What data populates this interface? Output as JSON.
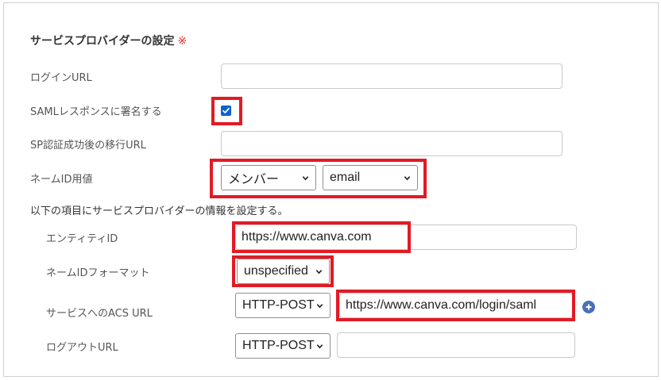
{
  "section": {
    "title": "サービスプロバイダーの設定",
    "required_mark": "※"
  },
  "fields": {
    "login_url": {
      "label": "ログインURL",
      "value": ""
    },
    "sign_saml": {
      "label": "SAMLレスポンスに署名する",
      "checked": true
    },
    "post_login_url": {
      "label": "SP認証成功後の移行URL",
      "value": ""
    },
    "name_id_value": {
      "label": "ネームID用値",
      "select1": "メンバー",
      "select2": "email"
    }
  },
  "subsection": {
    "intro": "以下の項目にサービスプロバイダーの情報を設定する。",
    "entity_id": {
      "label": "エンティティID",
      "value": "https://www.canva.com"
    },
    "name_id_format": {
      "label": "ネームIDフォーマット",
      "select": "unspecified"
    },
    "acs_url": {
      "label": "サービスへのACS URL",
      "method": "HTTP-POST",
      "value": "https://www.canva.com/login/saml"
    },
    "logout_url": {
      "label": "ログアウトURL",
      "method": "HTTP-POST",
      "value": ""
    }
  },
  "icons": {
    "add": "plus-circle-icon",
    "chevron": "chevron-down-icon",
    "check": "check-icon"
  },
  "colors": {
    "highlight": "#e21a24",
    "checkbox": "#0b63ce",
    "add_icon": "#4a6fb8",
    "required": "#e0342f"
  }
}
